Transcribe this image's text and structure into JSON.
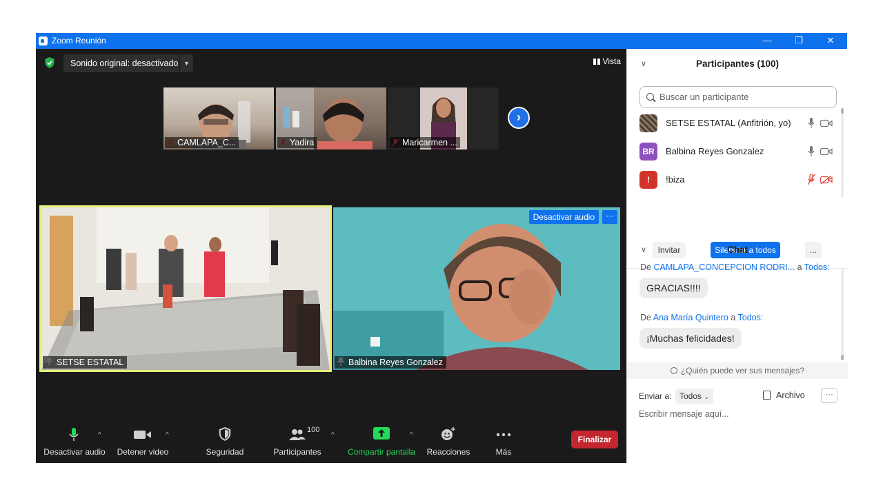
{
  "window": {
    "title": "Zoom Reunión",
    "controls": [
      "—",
      "❐",
      "✕"
    ]
  },
  "video": {
    "sound_label": "Sonido original: desactivado",
    "view_label": "Vista",
    "thumbnails": [
      {
        "name": "CAMLAPA_C...",
        "bg": "#b7a79a"
      },
      {
        "name": "Yadira",
        "bg": "#8d7a6c"
      },
      {
        "name": "Maricarmen ...",
        "bg": "#2a2a2a"
      }
    ],
    "main_tiles": [
      {
        "name": "SETSE ESTATAL",
        "active": true
      },
      {
        "name": "Balbina Reyes Gonzalez",
        "active": false
      }
    ],
    "deactivate_audio": "Desactivar audio",
    "tile_more": "···"
  },
  "toolbar": {
    "mute": "Desactivar audio",
    "video": "Detener video",
    "security": "Seguridad",
    "participants": "Participantes",
    "participant_count": "100",
    "share": "Compartir pantalla",
    "reactions": "Reacciones",
    "more": "Más",
    "end": "Finalizar",
    "share_color": "#23d959",
    "end_color": "#c5272f"
  },
  "participants": {
    "header": "Participantes (100)",
    "search_placeholder": "Buscar un participante",
    "list": [
      {
        "name": "SETSE ESTATAL (Anfitrión, yo)",
        "initials": "",
        "color": "#5b4a3a",
        "muted": false
      },
      {
        "name": "Balbina Reyes Gonzalez",
        "initials": "BR",
        "color": "#8e4fbf",
        "muted": false
      },
      {
        "name": "!biza",
        "initials": "!",
        "color": "#d2342a",
        "muted": true
      }
    ],
    "invite": "Invitar",
    "mute_all": "Silenciar a todos",
    "more": "..."
  },
  "chat": {
    "header": "Chat",
    "messages": [
      {
        "from_prefix": "De ",
        "from": "CAMLAPA_CONCEPCION RODRI...",
        "to_prefix": " a ",
        "to": "Todos:",
        "text": "GRACIAS!!!!"
      },
      {
        "from_prefix": "De ",
        "from": "Ana María Quintero",
        "to_prefix": " a ",
        "to": "Todos:",
        "text": "¡Muchas felicidades!"
      }
    ],
    "who_sees": "¿Quién puede ver sus mensajes?",
    "send_to_label": "Enviar a:",
    "send_to_value": "Todos",
    "file_label": "Archivo",
    "more": "···",
    "input_placeholder": "Escribir mensaje aquí..."
  },
  "colors": {
    "zoom_blue": "#0e72ed",
    "active_border": "#e4f07a",
    "meeting_bg": "#1a1a1a"
  }
}
